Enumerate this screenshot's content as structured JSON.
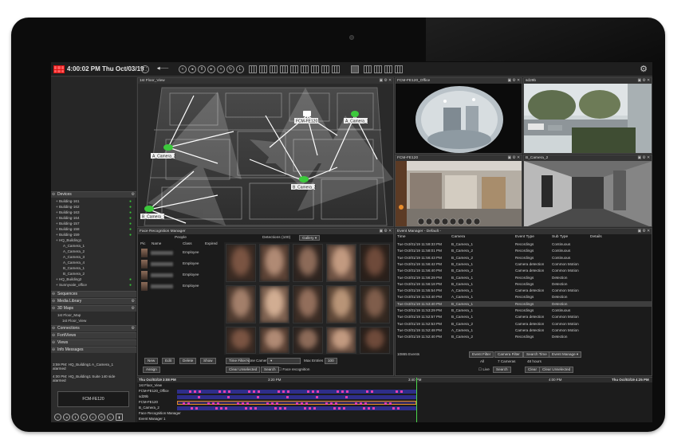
{
  "topbar": {
    "clock": "4:00:02 PM Thu Oct/03/19"
  },
  "map": {
    "title": "1st Floor_View",
    "cameras": [
      "FCM-FE120",
      "A_Camera_1",
      "A_Camera_2",
      "B_Camera_2",
      "B_Camera_1"
    ]
  },
  "cam_panels": [
    "FCM-FE120_Office",
    "sd29b",
    "FCM-FE120",
    "B_Camera_2"
  ],
  "sidebar": {
    "devices_title": "Devices",
    "devices": [
      {
        "label": "Building-161",
        "sub": false,
        "online": true
      },
      {
        "label": "Building-162",
        "sub": false,
        "online": true
      },
      {
        "label": "Building-163",
        "sub": false,
        "online": true
      },
      {
        "label": "Building-164",
        "sub": false,
        "online": true
      },
      {
        "label": "Building-157",
        "sub": false,
        "online": true
      },
      {
        "label": "Building-158",
        "sub": false,
        "online": true
      },
      {
        "label": "Building-159",
        "sub": false,
        "online": true
      },
      {
        "label": "HQ_Building1",
        "sub": false,
        "online": false
      },
      {
        "label": "A_Camera_1",
        "sub": true,
        "online": false
      },
      {
        "label": "A_Camera_2",
        "sub": true,
        "online": false
      },
      {
        "label": "A_Camera_3",
        "sub": true,
        "online": false
      },
      {
        "label": "A_Camera_4",
        "sub": true,
        "online": false
      },
      {
        "label": "B_Camera_1",
        "sub": true,
        "online": false
      },
      {
        "label": "B_Camera_2",
        "sub": true,
        "online": false
      },
      {
        "label": "HQ_Building2",
        "sub": false,
        "online": true
      },
      {
        "label": "Sunnyvale_office",
        "sub": false,
        "online": true
      }
    ],
    "sections": [
      "Sequences",
      "Media Library",
      "3D Maps",
      "Connections",
      "FortiViews",
      "Views",
      "Info Messages"
    ],
    "maps_items": [
      "1st Floor_Map",
      "1st Floor_View"
    ],
    "notif1": "3:59 PM: HQ_Building1 A_Camera_1 alarmed",
    "notif2": "4:00 PM: HQ_Building1 Suite 140 side alarmed",
    "mini_camera": "FCM-FE120"
  },
  "face": {
    "title": "Face Recognition Manager",
    "people_label": "People",
    "cols": [
      "Pic",
      "Name",
      "Class",
      "Expired"
    ],
    "class_value": "Employee",
    "detections_label": "Detections (100)",
    "gallery_label": "Gallery",
    "buttons": [
      "New",
      "Edit",
      "Delete",
      "Show",
      "Assign"
    ],
    "filter_buttons": [
      "Time Filter",
      "None",
      "Camera",
      "Max Entries",
      "100"
    ],
    "clear_label": "Clear Unselected",
    "search_label": "Search",
    "face_rec_label": "Face recognition"
  },
  "events": {
    "title": "Event Manager - Default -",
    "cols": [
      "Time",
      "Camera",
      "Event Type",
      "Sub Type",
      "Details"
    ],
    "rows": [
      [
        "Tue Oct/01/19 11:59:33 PM",
        "B_Camera_1",
        "Recordings",
        "Continuous"
      ],
      [
        "Tue Oct/01/19 11:58:01 PM",
        "B_Camera_2",
        "Recordings",
        "Continuous"
      ],
      [
        "Tue Oct/01/19 11:56:43 PM",
        "B_Camera_2",
        "Recordings",
        "Continuous"
      ],
      [
        "Tue Oct/01/19 11:56:42 PM",
        "B_Camera_1",
        "Camera detection",
        "Common Motion"
      ],
      [
        "Tue Oct/01/19 11:56:40 PM",
        "B_Camera_2",
        "Camera detection",
        "Common Motion"
      ],
      [
        "Tue Oct/01/19 11:56:29 PM",
        "B_Camera_1",
        "Recordings",
        "Detection"
      ],
      [
        "Tue Oct/01/19 11:56:18 PM",
        "B_Camera_1",
        "Recordings",
        "Detection"
      ],
      [
        "Tue Oct/01/19 11:55:54 PM",
        "A_Camera_1",
        "Camera detection",
        "Common Motion"
      ],
      [
        "Tue Oct/01/19 11:53:40 PM",
        "A_Camera_1",
        "Recordings",
        "Detection"
      ],
      [
        "Tue Oct/01/19 11:53:40 PM",
        "B_Camera_1",
        "Recordings",
        "Detection"
      ],
      [
        "Tue Oct/01/19 11:53:29 PM",
        "B_Camera_1",
        "Recordings",
        "Continuous"
      ],
      [
        "Tue Oct/01/19 11:52:57 PM",
        "B_Camera_1",
        "Camera detection",
        "Common Motion"
      ],
      [
        "Tue Oct/01/19 11:52:53 PM",
        "B_Camera_2",
        "Camera detection",
        "Common Motion"
      ],
      [
        "Tue Oct/01/19 11:52:48 PM",
        "A_Camera_1",
        "Camera detection",
        "Common Motion"
      ],
      [
        "Tue Oct/01/19 11:52:40 PM",
        "B_Camera_2",
        "Recordings",
        "Detection"
      ]
    ],
    "count": "10865 Events",
    "buttons": [
      "Event Filter",
      "Camera Filter",
      "Search Time",
      "Event Manage"
    ],
    "filter_vals": [
      "All",
      "7 Cameras",
      "48 hours"
    ],
    "bottom_btns": [
      "Live",
      "Search",
      "Clear",
      "Clear Unselected"
    ]
  },
  "timeline": {
    "start": "Thu Oct/03/19 3:08 PM",
    "end": "Thu Oct/03/19 4:25 PM",
    "ticks": [
      "3:20 PM",
      "3:40 PM",
      "4:00 PM"
    ],
    "rows": [
      "1st Floor_View",
      "FCM-FE120_Office",
      "sd29b",
      "FCM-FE120",
      "B_Camera_2",
      "Face Recognition Manager",
      "Event Manager 1"
    ]
  }
}
